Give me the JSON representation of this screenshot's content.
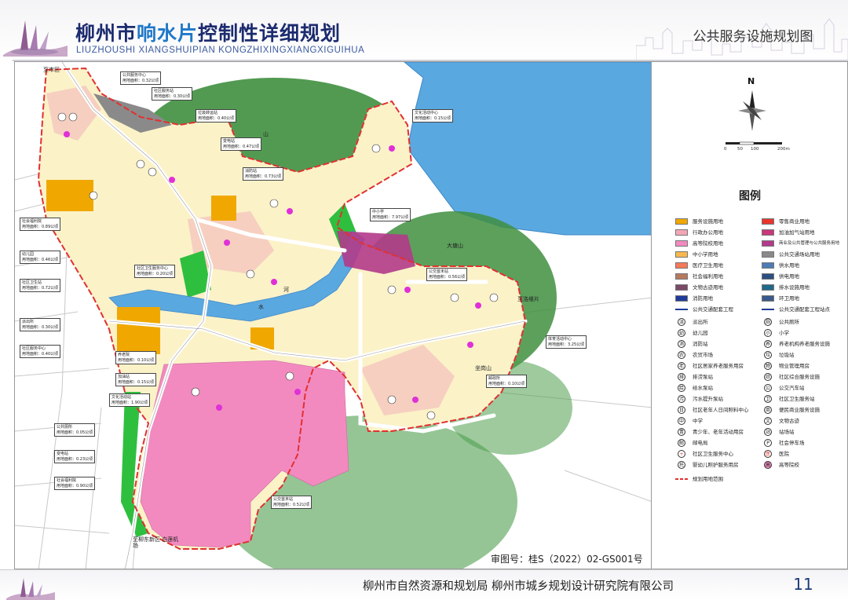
{
  "header": {
    "title_prefix": "柳州市",
    "title_highlight": "响水片",
    "title_suffix": "控制性详细规划",
    "title_en": "LIUZHOUSHI  XIANGSHUIPIAN  KONGZHIXINGXIANGXIGUIHUA",
    "sheet_title": "公共服务设施规划图"
  },
  "map": {
    "place_labels": [
      {
        "id": "map-label-top-left",
        "text": "至市区"
      },
      {
        "id": "map-label-mountain-1",
        "text": "山"
      },
      {
        "id": "map-label-mountain-2",
        "text": "大塘山"
      },
      {
        "id": "map-label-mountain-3",
        "text": "坐岗山"
      },
      {
        "id": "map-label-river-1",
        "text": "河"
      },
      {
        "id": "map-label-river-2",
        "text": "水"
      },
      {
        "id": "map-label-east",
        "text": "至洛维片"
      },
      {
        "id": "map-label-south",
        "text": "至柳东新区 白莲机场"
      }
    ],
    "callouts": [
      {
        "id": "callout-1",
        "lines": [
          "公共服务中心",
          "用地面积：0.32公顷"
        ]
      },
      {
        "id": "callout-2",
        "lines": [
          "社区服务站",
          "用地面积：0.30公顷"
        ]
      },
      {
        "id": "callout-3",
        "lines": [
          "垃圾转运站",
          "用地面积：0.40公顷"
        ]
      },
      {
        "id": "callout-4",
        "lines": [
          "变电站",
          "用地面积：0.47公顷"
        ]
      },
      {
        "id": "callout-5",
        "lines": [
          "消防站",
          "用地面积：0.73公顷"
        ]
      },
      {
        "id": "callout-6",
        "lines": [
          "文化活动中心",
          "用地面积：0.15公顷"
        ]
      },
      {
        "id": "callout-7",
        "lines": [
          "中小学",
          "用地面积：7.97公顷"
        ]
      },
      {
        "id": "callout-8",
        "lines": [
          "社区卫生服务中心",
          "用地面积：0.20公顷"
        ]
      },
      {
        "id": "callout-9",
        "lines": [
          "公交首末站",
          "用地面积：0.56公顷"
        ]
      },
      {
        "id": "callout-10",
        "lines": [
          "体育活动中心",
          "用地面积：3.25公顷"
        ]
      },
      {
        "id": "callout-11",
        "lines": [
          "邮政所",
          "用地面积：0.10公顷"
        ]
      },
      {
        "id": "callout-12",
        "lines": [
          "养老院",
          "用地面积：0.10公顷"
        ]
      },
      {
        "id": "callout-13",
        "lines": [
          "加油站",
          "用地面积：0.15公顷"
        ]
      },
      {
        "id": "callout-14",
        "lines": [
          "文化活动站",
          "用地面积：1.90公顷"
        ]
      },
      {
        "id": "callout-15",
        "lines": [
          "社会福利院",
          "用地面积：0.89公顷"
        ]
      },
      {
        "id": "callout-16",
        "lines": [
          "幼儿园",
          "用地面积：0.46公顷"
        ]
      },
      {
        "id": "callout-17",
        "lines": [
          "社区卫生站",
          "用地面积：0.72公顷"
        ]
      },
      {
        "id": "callout-18",
        "lines": [
          "派出所",
          "用地面积：0.30公顷"
        ]
      },
      {
        "id": "callout-19",
        "lines": [
          "社区服务中心",
          "用地面积：0.40公顷"
        ]
      },
      {
        "id": "callout-20",
        "lines": [
          "公共厕所",
          "用地面积：0.05公顷"
        ]
      },
      {
        "id": "callout-21",
        "lines": [
          "变电站",
          "用地面积：0.23公顷"
        ]
      },
      {
        "id": "callout-22",
        "lines": [
          "社会福利院",
          "用地面积：0.90公顷"
        ]
      },
      {
        "id": "callout-23",
        "lines": [
          "公交首末站",
          "用地面积：0.52公顷"
        ]
      }
    ],
    "review_number": "审图号：桂S（2022）02-GS001号"
  },
  "legend": {
    "north": "N",
    "scale_ticks": [
      "0",
      "50",
      "100",
      "200m"
    ],
    "title": "图例",
    "colors": {
      "service": "#f0a800",
      "commerce": "#e8352f",
      "admin": "#f4a6b6",
      "utility_pink": "#c8387a",
      "higher_edu": "#f28ac0",
      "mixed": "#b23a8a",
      "school": "#f8b84e",
      "transport": "#8a8a8a",
      "medical": "#f47a5a",
      "water_supply": "#4f7bb5",
      "welfare": "#b67a5e",
      "power": "#2b4f80",
      "cultural": "#7a4a68",
      "drainage": "#1f6a8a",
      "fire": "#1f3c9a",
      "sanitation": "#3a5a8a",
      "green": "#2fbf3f",
      "forest": "#3f8f3f",
      "residential": "#fbf2c8",
      "industrial": "#f6cfc0",
      "water": "#5aa8e0",
      "boundary": "#e23030",
      "road": "#d0d0d0"
    },
    "land_use": [
      {
        "label": "服务设施用地",
        "color": "#f0a800"
      },
      {
        "label": "零售商业用地",
        "color": "#e8352f"
      },
      {
        "label": "行政办公用地",
        "color": "#f4a6b6"
      },
      {
        "label": "加油加气站用地",
        "color": "#c8387a"
      },
      {
        "label": "高等院校用地",
        "color": "#f28ac0"
      },
      {
        "label": "商业及公共管理与公共服务用地",
        "color": "#b23a8a"
      },
      {
        "label": "中小学用地",
        "color": "#f8b84e"
      },
      {
        "label": "公共交通场站用地",
        "color": "#8a8a8a"
      },
      {
        "label": "医疗卫生用地",
        "color": "#f47a5a"
      },
      {
        "label": "供水用地",
        "color": "#4f7bb5"
      },
      {
        "label": "社会福利用地",
        "color": "#b67a5e"
      },
      {
        "label": "供电用地",
        "color": "#2b4f80"
      },
      {
        "label": "文物古迹用地",
        "color": "#7a4a68"
      },
      {
        "label": "排水设施用地",
        "color": "#1f6a8a"
      },
      {
        "label": "消防用地",
        "color": "#1f3c9a"
      },
      {
        "label": "环卫用地",
        "color": "#3a5a8a"
      }
    ],
    "lines": [
      {
        "label": "公共交通配套工程",
        "color": "#1f3c9a"
      },
      {
        "label": "公共交通配套工程站点",
        "color": "#1f3c9a"
      }
    ],
    "facilities": [
      {
        "symbol": "派",
        "label": "派出所"
      },
      {
        "symbol": "厕",
        "label": "公共厕所"
      },
      {
        "symbol": "幼",
        "label": "幼儿园"
      },
      {
        "symbol": "小",
        "label": "小学"
      },
      {
        "symbol": "消",
        "label": "消防站"
      },
      {
        "symbol": "养",
        "label": "养老机构养老服务设施"
      },
      {
        "symbol": "农",
        "label": "农贸市场"
      },
      {
        "symbol": "垃",
        "label": "垃圾站"
      },
      {
        "symbol": "老",
        "label": "社区居家养老服务用房"
      },
      {
        "symbol": "物",
        "label": "物业管理用房"
      },
      {
        "symbol": "排",
        "label": "排涝泵站"
      },
      {
        "symbol": "综",
        "label": "社区综合服务设施"
      },
      {
        "symbol": "给",
        "label": "给水泵站"
      },
      {
        "symbol": "公",
        "label": "公交汽车站"
      },
      {
        "symbol": "污",
        "label": "污水提升泵站"
      },
      {
        "symbol": "卫",
        "label": "社区卫生服务站"
      },
      {
        "symbol": "日",
        "label": "社区老年人日间照料中心"
      },
      {
        "symbol": "商",
        "label": "便民商业服务设施"
      },
      {
        "symbol": "中",
        "label": "中学"
      },
      {
        "symbol": "文",
        "label": "文物古迹"
      },
      {
        "symbol": "青",
        "label": "青少年、老年活动用房"
      },
      {
        "symbol": "站",
        "label": "站场站"
      },
      {
        "symbol": "邮",
        "label": "邮电局"
      },
      {
        "symbol": "P",
        "label": "社会停车场"
      },
      {
        "symbol": "+",
        "label": "社区卫生服务中心"
      },
      {
        "symbol": "医",
        "label": "医院"
      },
      {
        "symbol": "托",
        "label": "婴幼儿照护服务用房"
      },
      {
        "symbol": "高",
        "label": "高等院校"
      }
    ],
    "boundary_label": "规划用地范围"
  },
  "footer": {
    "org_text": "柳州市自然资源和规划局     柳州市城乡规划设计研究院有限公司",
    "page_number": "11"
  }
}
